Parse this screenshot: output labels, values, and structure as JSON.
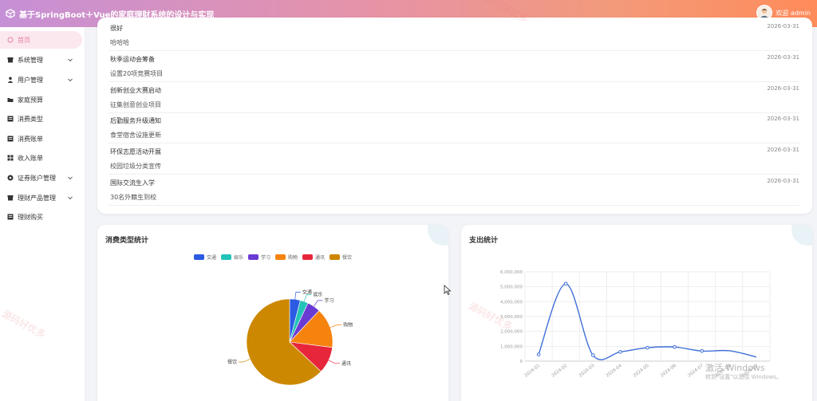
{
  "header": {
    "app_title": "基于SpringBoot＋Vue的家庭理财系统的设计与实现",
    "user_label": "欢迎 admin"
  },
  "sidebar": {
    "items": [
      {
        "label": "首页",
        "icon": "home-icon",
        "active": true
      },
      {
        "label": "系统管理",
        "icon": "shop-icon",
        "expandable": true
      },
      {
        "label": "用户管理",
        "icon": "person-icon",
        "expandable": true
      },
      {
        "label": "家庭预算",
        "icon": "folder-icon"
      },
      {
        "label": "消费类型",
        "icon": "document-icon"
      },
      {
        "label": "消费账单",
        "icon": "document-icon"
      },
      {
        "label": "收入账单",
        "icon": "grid-icon"
      },
      {
        "label": "证券账户管理",
        "icon": "gear-icon",
        "expandable": true
      },
      {
        "label": "理财产品管理",
        "icon": "shop-icon",
        "expandable": true
      },
      {
        "label": "理财购买",
        "icon": "document-icon"
      }
    ]
  },
  "news": [
    {
      "title": "很好",
      "desc": "哈哈哈",
      "date": "2026-03-31"
    },
    {
      "title": "秋季运动会筹备",
      "desc": "设置20项竞赛项目",
      "date": "2026-03-31"
    },
    {
      "title": "创新创业大赛启动",
      "desc": "征集创意创业项目",
      "date": "2026-03-31"
    },
    {
      "title": "后勤服务升级通知",
      "desc": "食堂宿舍设施更新",
      "date": "2026-03-31"
    },
    {
      "title": "环保志愿活动开展",
      "desc": "校园垃圾分类宣传",
      "date": "2026-03-31"
    },
    {
      "title": "国际交流生入学",
      "desc": "30名外籍生到校",
      "date": "2026-03-31"
    }
  ],
  "pie_card": {
    "title": "消费类型统计"
  },
  "line_card": {
    "title": "支出统计"
  },
  "chart_data": [
    {
      "type": "pie",
      "title": "消费类型统计",
      "legend_position": "top",
      "series": [
        {
          "name": "交通",
          "value": 4,
          "color": "#2b5ae3"
        },
        {
          "name": "娱乐",
          "value": 3,
          "color": "#22c3b8"
        },
        {
          "name": "学习",
          "value": 5,
          "color": "#6a3bd3"
        },
        {
          "name": "购物",
          "value": 15,
          "color": "#f7830f"
        },
        {
          "name": "通讯",
          "value": 10,
          "color": "#e8263b"
        },
        {
          "name": "餐饮",
          "value": 63,
          "color": "#cc8800"
        }
      ]
    },
    {
      "type": "line",
      "title": "支出统计",
      "categories": [
        "2024-01",
        "2024-02",
        "2024-03",
        "2024-04",
        "2024-05",
        "2024-06",
        "2024-07",
        "2024-08",
        "2024-09"
      ],
      "values": [
        450000,
        5200000,
        400000,
        620000,
        900000,
        950000,
        680000,
        700000,
        280000
      ],
      "ylim": [
        0,
        6000000
      ],
      "yticks": [
        "0",
        "1,000,000",
        "2,000,000",
        "3,000,000",
        "4,000,000",
        "5,000,000",
        "6,000,000"
      ],
      "grid": true,
      "color": "#3f6fd8"
    }
  ],
  "watermarks": {
    "site": "源码好优多",
    "windows_title": "激活 Windows",
    "windows_sub": "转到\"设置\"以激活 Windows。"
  }
}
